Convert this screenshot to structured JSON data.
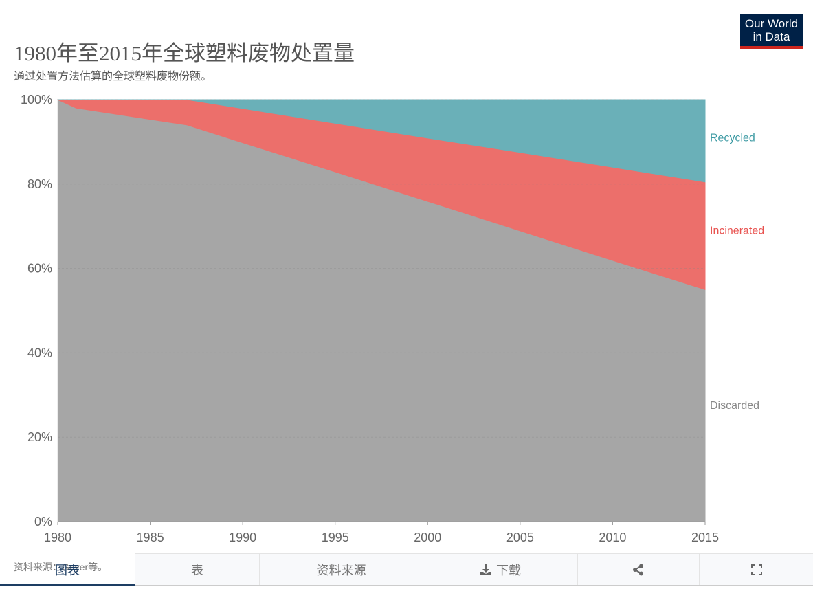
{
  "header": {
    "title": "1980年至2015年全球塑料废物处置量",
    "subtitle": "通过处置方法估算的全球塑料废物份额。",
    "logo": "Our World in Data"
  },
  "footer": {
    "source": "资料来源：Geyer等。"
  },
  "tabs": {
    "chart": "图表",
    "table": "表",
    "sources": "资料来源",
    "download": "下载",
    "share_icon": "share-icon",
    "fullscreen_icon": "fullscreen-icon",
    "download_icon": "download-icon"
  },
  "chart_data": {
    "type": "area",
    "stacked": "percent",
    "title": "1980年至2015年全球塑料废物处置量",
    "subtitle": "通过处置方法估算的全球塑料废物份额。",
    "x": [
      1980,
      1981,
      1987,
      1990,
      1995,
      2000,
      2005,
      2010,
      2015
    ],
    "series": [
      {
        "name": "Discarded",
        "color": "#a6a6a6",
        "values": [
          100,
          98,
          94,
          89.8,
          82.9,
          75.9,
          68.9,
          61.9,
          55
        ]
      },
      {
        "name": "Incinerated",
        "color": "#ec6f6b",
        "values": [
          0,
          2,
          6,
          8.1,
          11.5,
          15,
          18.6,
          22.1,
          25.5
        ]
      },
      {
        "name": "Recycled",
        "color": "#6ab0b8",
        "values": [
          0,
          0,
          0,
          2.1,
          5.6,
          9.1,
          12.5,
          16,
          19.5
        ]
      }
    ],
    "xticks": [
      "1980",
      "1985",
      "1990",
      "1995",
      "2000",
      "2005",
      "2010",
      "2015"
    ],
    "yticks": [
      "0%",
      "20%",
      "40%",
      "60%",
      "80%",
      "100%"
    ],
    "xlim": [
      1980,
      2015
    ],
    "ylim": [
      0,
      100
    ],
    "grid": "horizontal dashed",
    "legend": "right inline labels",
    "label_colors": {
      "Discarded": "#888888",
      "Incinerated": "#e8524f",
      "Recycled": "#3c9aa3"
    }
  }
}
